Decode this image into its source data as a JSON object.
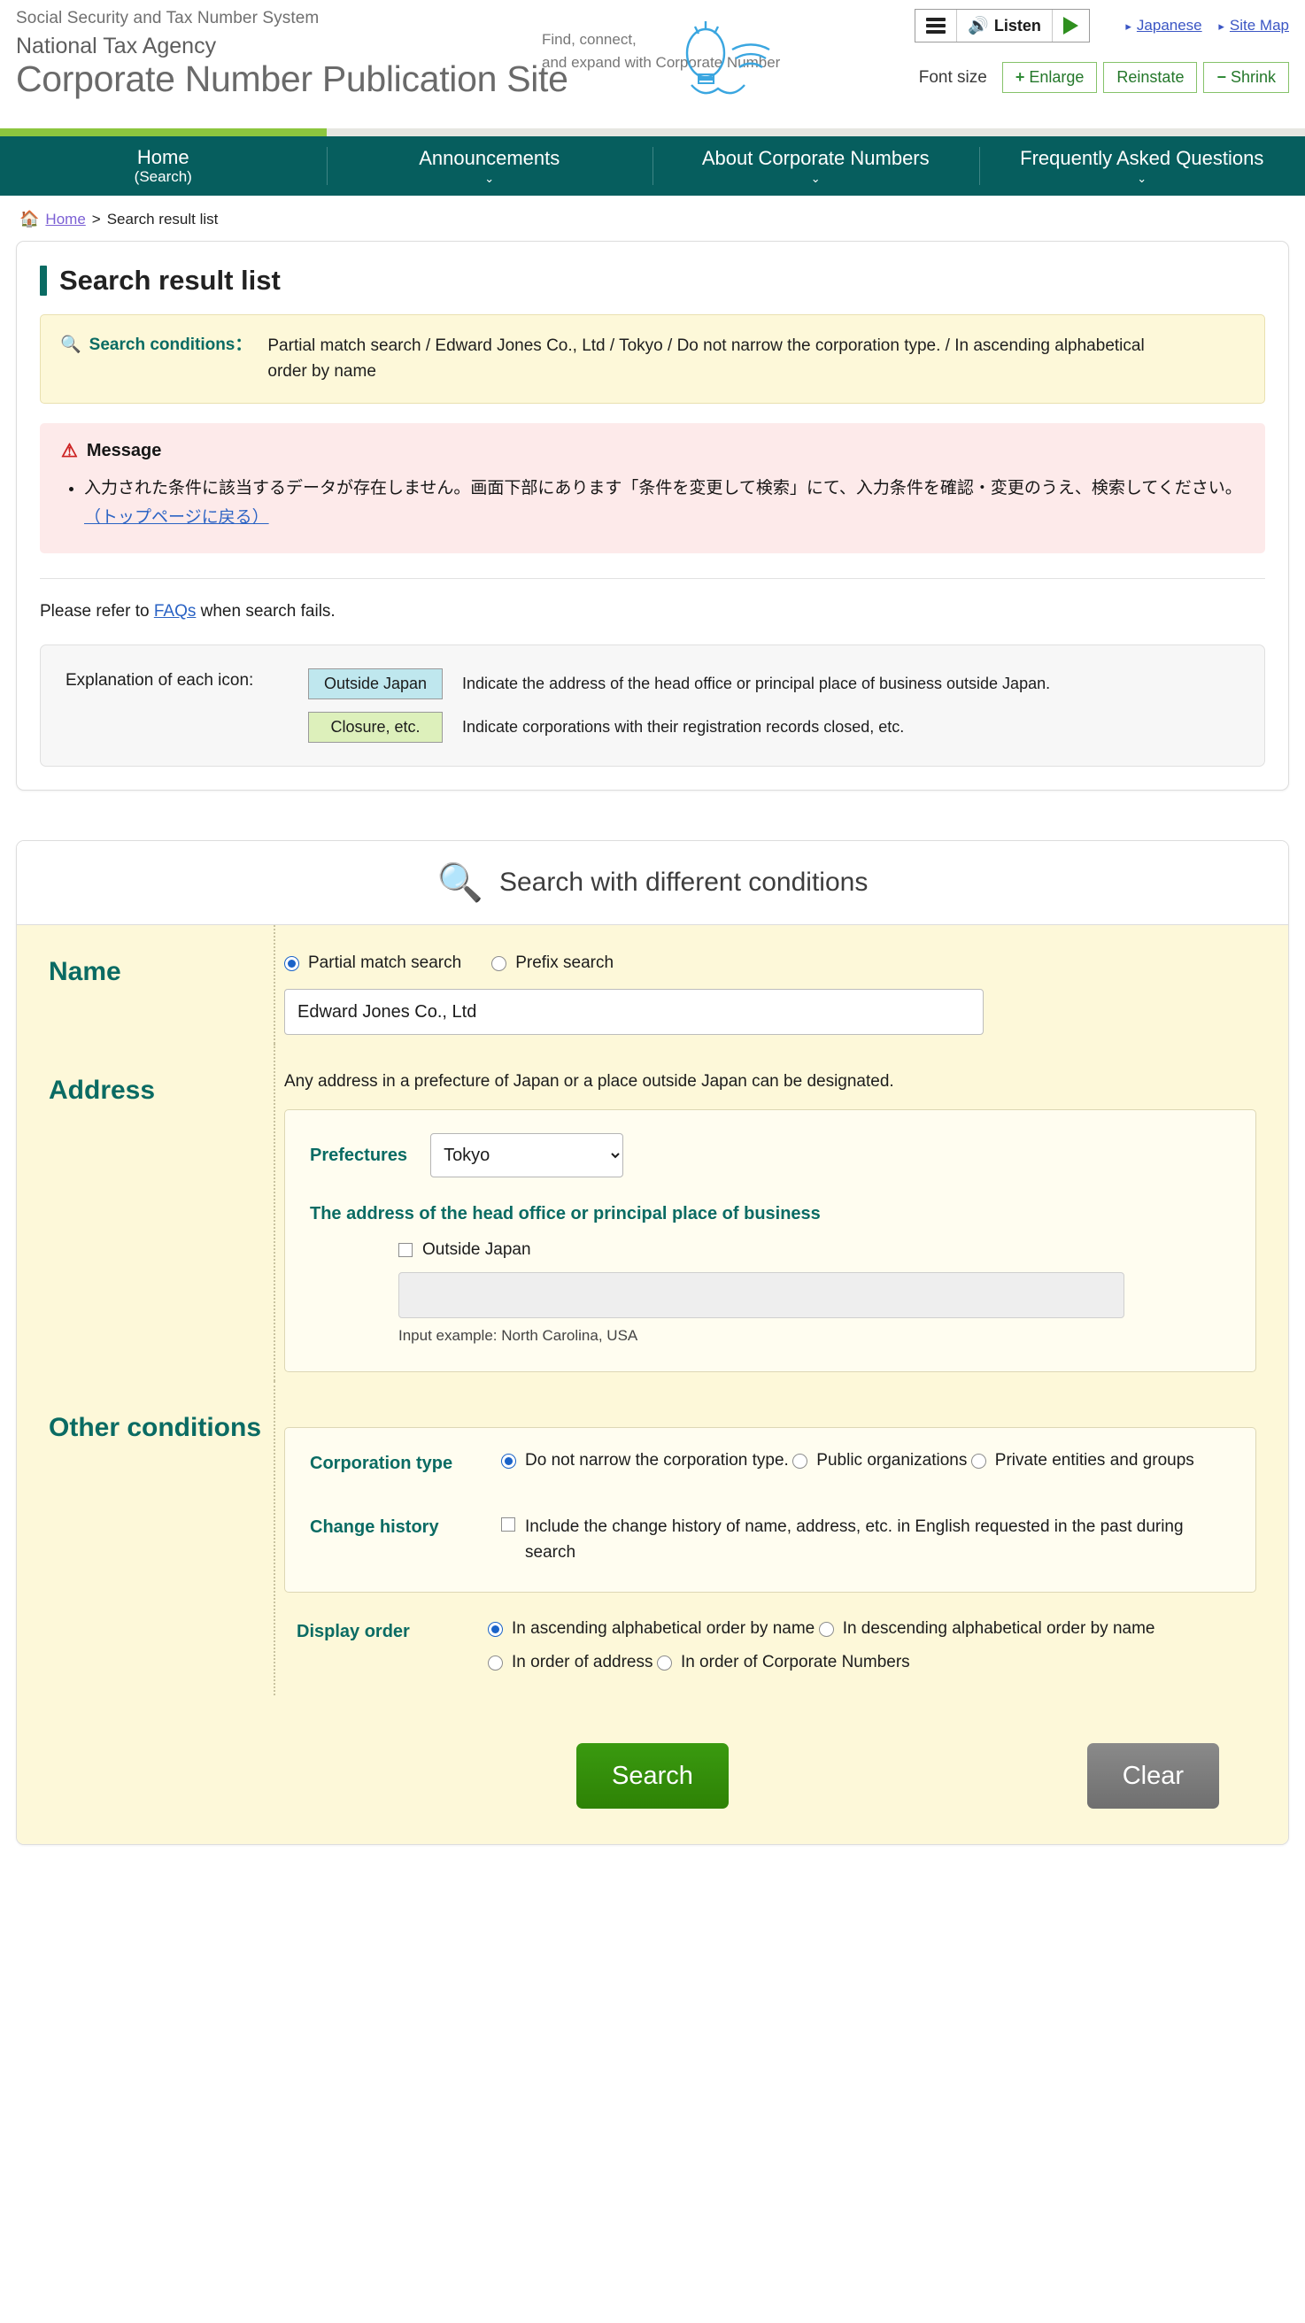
{
  "header": {
    "system_name": "Social Security and Tax Number System",
    "agency": "National Tax Agency",
    "site_title": "Corporate Number Publication Site",
    "tagline_line1": "Find, connect,",
    "tagline_line2": "and expand with Corporate Number",
    "listen_label": "Listen",
    "japanese_link": "Japanese",
    "sitemap_link": "Site Map",
    "font_size_label": "Font size",
    "enlarge": "Enlarge",
    "reinstate": "Reinstate",
    "shrink": "Shrink",
    "enlarge_sym": "+",
    "shrink_sym": "−"
  },
  "nav": [
    {
      "label": "Home",
      "sub": "(Search)",
      "caret": "",
      "active": true
    },
    {
      "label": "Announcements",
      "sub": "",
      "caret": "⌄",
      "active": false
    },
    {
      "label": "About Corporate Numbers",
      "sub": "",
      "caret": "⌄",
      "active": false
    },
    {
      "label": "Frequently Asked Questions",
      "sub": "",
      "caret": "⌄",
      "active": false
    }
  ],
  "breadcrumb": {
    "home": "Home",
    "separator": ">",
    "current": "Search result list"
  },
  "result": {
    "page_title": "Search result list",
    "conditions_label": "Search conditions：",
    "conditions_value": "Partial match search / Edward Jones Co., Ltd / Tokyo / Do not narrow the corporation type. / In ascending alphabetical order by name",
    "message_heading": "Message",
    "message_text": "入力された条件に該当するデータが存在しません。画面下部にあります「条件を変更して検索」にて、入力条件を確認・変更のうえ、検索してください。",
    "message_link": "（トップページに戻る）",
    "faq_prefix": "Please refer to ",
    "faq_link": "FAQs",
    "faq_suffix": " when search fails.",
    "icon_explanation_label": "Explanation of each icon:",
    "icons": [
      {
        "chip": "Outside Japan",
        "desc": "Indicate the address of the head office or principal place of business outside Japan."
      },
      {
        "chip": "Closure, etc.",
        "desc": "Indicate corporations with their registration records closed, etc."
      }
    ]
  },
  "search_panel": {
    "title": "Search with different conditions",
    "name": {
      "label": "Name",
      "match_options": [
        {
          "label": "Partial match search",
          "selected": true
        },
        {
          "label": "Prefix search",
          "selected": false
        }
      ],
      "value": "Edward Jones Co., Ltd"
    },
    "address": {
      "label": "Address",
      "helper": "Any address in a prefecture of Japan or a place outside Japan can be designated.",
      "prefectures_label": "Prefectures",
      "prefecture_selected": "Tokyo",
      "prefecture_options": [
        "Tokyo"
      ],
      "head_office_title": "The address of the head office or principal place of business",
      "outside_japan_label": "Outside Japan",
      "outside_japan_checked": false,
      "outside_value": "",
      "input_example": "Input example: North Carolina, USA"
    },
    "other": {
      "label": "Other conditions",
      "corporation_type_label": "Corporation type",
      "corporation_type_options": [
        {
          "label": "Do not narrow the corporation type.",
          "selected": true
        },
        {
          "label": "Public organizations",
          "selected": false
        },
        {
          "label": "Private entities and groups",
          "selected": false
        }
      ],
      "change_history_label": "Change history",
      "change_history_option": "Include the change history of name, address, etc. in English requested in the past during search",
      "change_history_checked": false,
      "display_order_label": "Display order",
      "display_order_options": [
        {
          "label": "In ascending alphabetical order by name",
          "selected": true
        },
        {
          "label": "In descending alphabetical order by name",
          "selected": false
        },
        {
          "label": "In order of address",
          "selected": false
        },
        {
          "label": "In order of Corporate Numbers",
          "selected": false
        }
      ]
    },
    "search_button": "Search",
    "clear_button": "Clear"
  },
  "colors": {
    "nav_teal": "#065e5e",
    "accent_green": "#8cc63f",
    "heading_teal": "#0a6b63",
    "form_bg": "#fdf8d9",
    "message_bg": "#fdeaea",
    "search_button": "#2e8b0a"
  }
}
